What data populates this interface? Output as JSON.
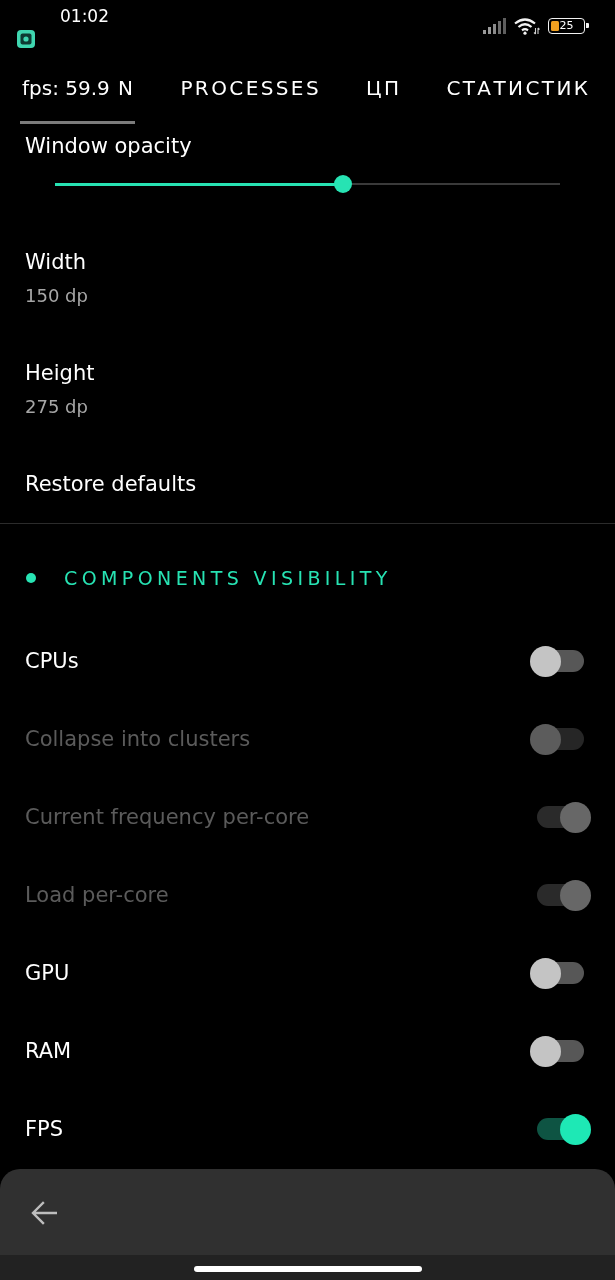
{
  "status_bar": {
    "time": "01:02",
    "battery": "25"
  },
  "overlay": {
    "text": "fps: 59.9"
  },
  "tabs": [
    {
      "label": "N",
      "selected": true
    },
    {
      "label": "PROCESSES",
      "selected": false
    },
    {
      "label": "ЦП",
      "selected": false
    },
    {
      "label": "СТАТИСТИК",
      "selected": false
    }
  ],
  "opacity": {
    "label": "Window opacity",
    "level": 0.57
  },
  "settings": [
    {
      "title": "Width",
      "value": "150 dp"
    },
    {
      "title": "Height",
      "value": "275 dp"
    },
    {
      "title": "Restore defaults"
    }
  ],
  "section": {
    "title": "COMPONENTS VISIBILITY"
  },
  "toggles": [
    {
      "label": "CPUs",
      "on": false,
      "disabled": false
    },
    {
      "label": "Collapse into clusters",
      "on": false,
      "disabled": true
    },
    {
      "label": "Current frequency per-core",
      "on": true,
      "disabled": true
    },
    {
      "label": "Load per-core",
      "on": true,
      "disabled": true
    },
    {
      "label": "GPU",
      "on": false,
      "disabled": false
    },
    {
      "label": "RAM",
      "on": false,
      "disabled": false
    },
    {
      "label": "FPS",
      "on": true,
      "disabled": false
    }
  ]
}
